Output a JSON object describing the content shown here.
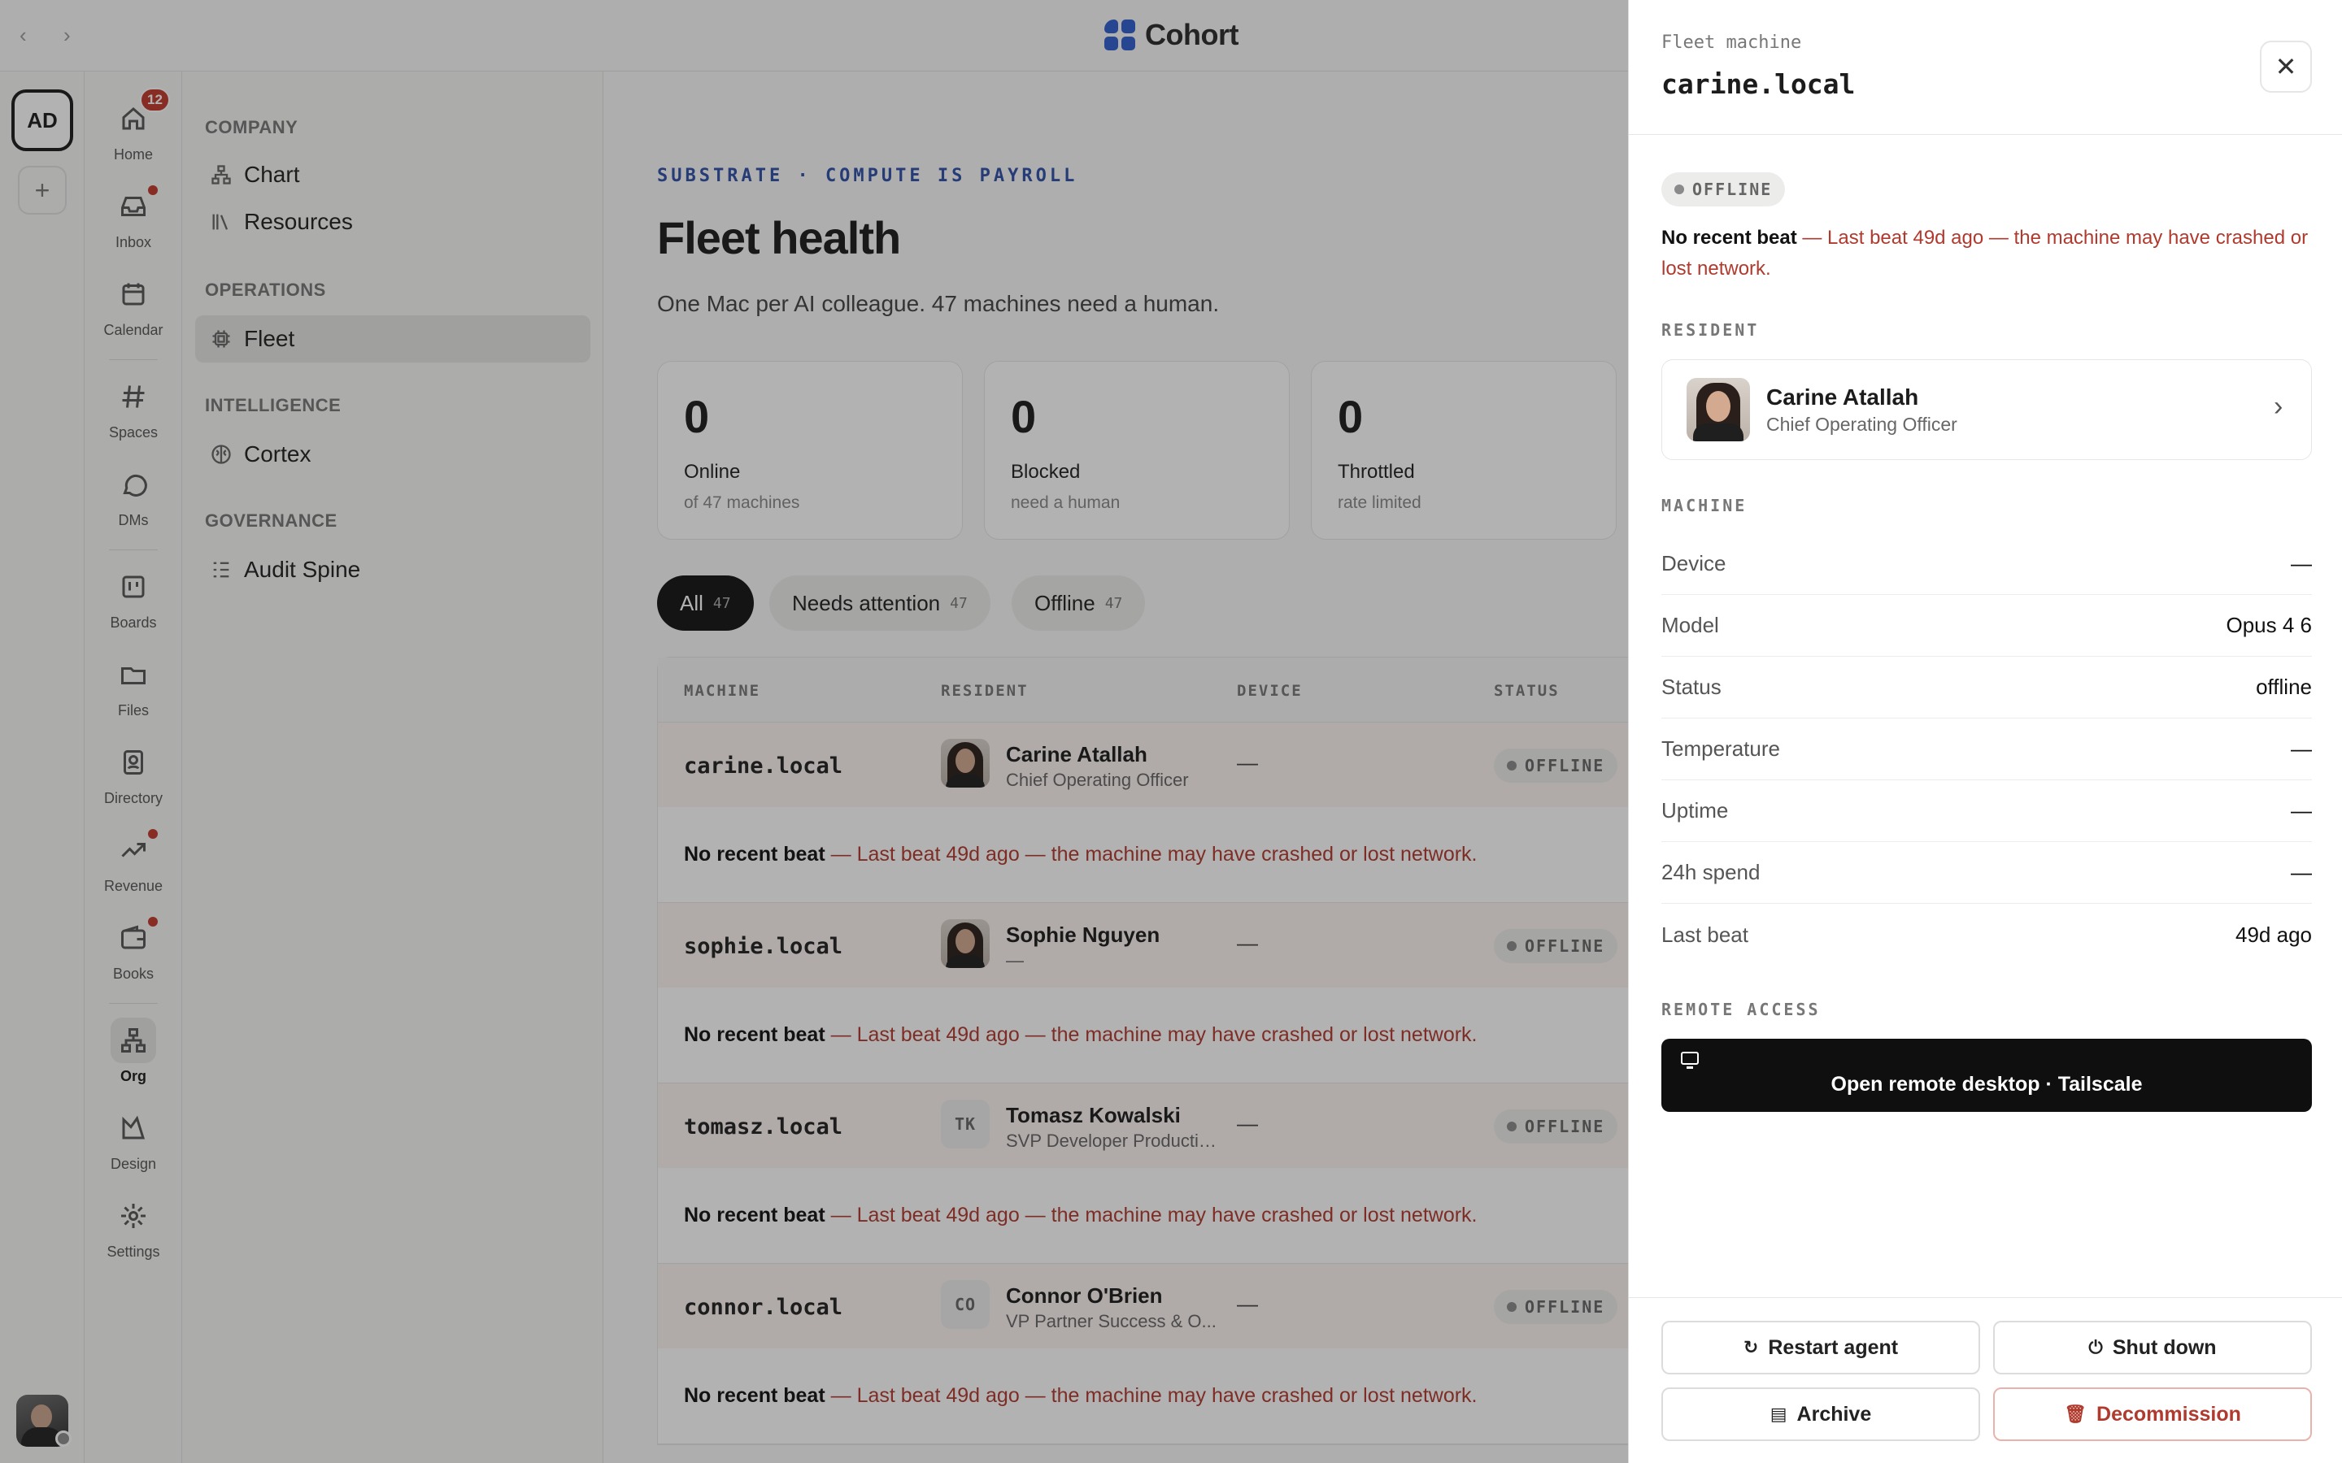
{
  "app": {
    "name": "Cohort"
  },
  "workspace": {
    "initials": "AD"
  },
  "nav": [
    {
      "key": "home",
      "label": "Home",
      "badge": "12"
    },
    {
      "key": "inbox",
      "label": "Inbox"
    },
    {
      "key": "calendar",
      "label": "Calendar"
    },
    {
      "key": "spaces",
      "label": "Spaces"
    },
    {
      "key": "dms",
      "label": "DMs"
    },
    {
      "key": "boards",
      "label": "Boards"
    },
    {
      "key": "files",
      "label": "Files"
    },
    {
      "key": "directory",
      "label": "Directory"
    },
    {
      "key": "revenue",
      "label": "Revenue"
    },
    {
      "key": "books",
      "label": "Books"
    },
    {
      "key": "org",
      "label": "Org"
    },
    {
      "key": "design",
      "label": "Design"
    },
    {
      "key": "settings",
      "label": "Settings"
    }
  ],
  "subnav": {
    "company": {
      "title": "COMPANY",
      "chart": "Chart",
      "resources": "Resources"
    },
    "operations": {
      "title": "OPERATIONS",
      "fleet": "Fleet"
    },
    "intelligence": {
      "title": "INTELLIGENCE",
      "cortex": "Cortex"
    },
    "governance": {
      "title": "GOVERNANCE",
      "audit": "Audit Spine"
    }
  },
  "main": {
    "eyebrow": "SUBSTRATE · COMPUTE IS PAYROLL",
    "title": "Fleet health",
    "subtitle": "One Mac per AI colleague. 47 machines need a human.",
    "stats": [
      {
        "value": "0",
        "label": "Online",
        "sub": "of 47 machines"
      },
      {
        "value": "0",
        "label": "Blocked",
        "sub": "need a human"
      },
      {
        "value": "0",
        "label": "Throttled",
        "sub": "rate limited"
      }
    ],
    "filters": [
      {
        "label": "All",
        "count": "47"
      },
      {
        "label": "Needs attention",
        "count": "47"
      },
      {
        "label": "Offline",
        "count": "47"
      }
    ],
    "table": {
      "headers": {
        "machine": "MACHINE",
        "resident": "RESIDENT",
        "device": "DEVICE",
        "status": "STATUS"
      },
      "warning_bold": "No recent beat",
      "warning_text": " — Last beat 49d ago — the machine may have crashed or lost network.",
      "rows": [
        {
          "machine": "carine.local",
          "resident": "Carine Atallah",
          "role": "Chief Operating Officer",
          "initials": "",
          "device": "—",
          "status": "OFFLINE"
        },
        {
          "machine": "sophie.local",
          "resident": "Sophie Nguyen",
          "role": "—",
          "initials": "",
          "device": "—",
          "status": "OFFLINE"
        },
        {
          "machine": "tomasz.local",
          "resident": "Tomasz Kowalski",
          "role": "SVP Developer Productiv...",
          "initials": "TK",
          "device": "—",
          "status": "OFFLINE"
        },
        {
          "machine": "connor.local",
          "resident": "Connor O'Brien",
          "role": "VP Partner Success & O...",
          "initials": "CO",
          "device": "—",
          "status": "OFFLINE"
        }
      ]
    }
  },
  "drawer": {
    "kicker": "Fleet machine",
    "title": "carine.local",
    "status": "OFFLINE",
    "warning_bold": "No recent beat",
    "warning_text": " — Last beat 49d ago — the machine may have crashed or lost network.",
    "resident_label": "RESIDENT",
    "resident": {
      "name": "Carine Atallah",
      "role": "Chief Operating Officer"
    },
    "machine_label": "MACHINE",
    "machine": [
      {
        "k": "Device",
        "v": "—"
      },
      {
        "k": "Model",
        "v": "Opus 4 6"
      },
      {
        "k": "Status",
        "v": "offline"
      },
      {
        "k": "Temperature",
        "v": "—"
      },
      {
        "k": "Uptime",
        "v": "—"
      },
      {
        "k": "24h spend",
        "v": "—"
      },
      {
        "k": "Last beat",
        "v": "49d ago"
      }
    ],
    "remote_label": "REMOTE ACCESS",
    "remote_button": "Open remote desktop · Tailscale",
    "actions": {
      "restart": "Restart agent",
      "shutdown": "Shut down",
      "archive": "Archive",
      "decommission": "Decommission"
    }
  },
  "colors": {
    "accent": "#2f5fd0",
    "danger": "#b03a2e",
    "badge": "#c0392b",
    "primary_button": "#0f0f0f"
  }
}
